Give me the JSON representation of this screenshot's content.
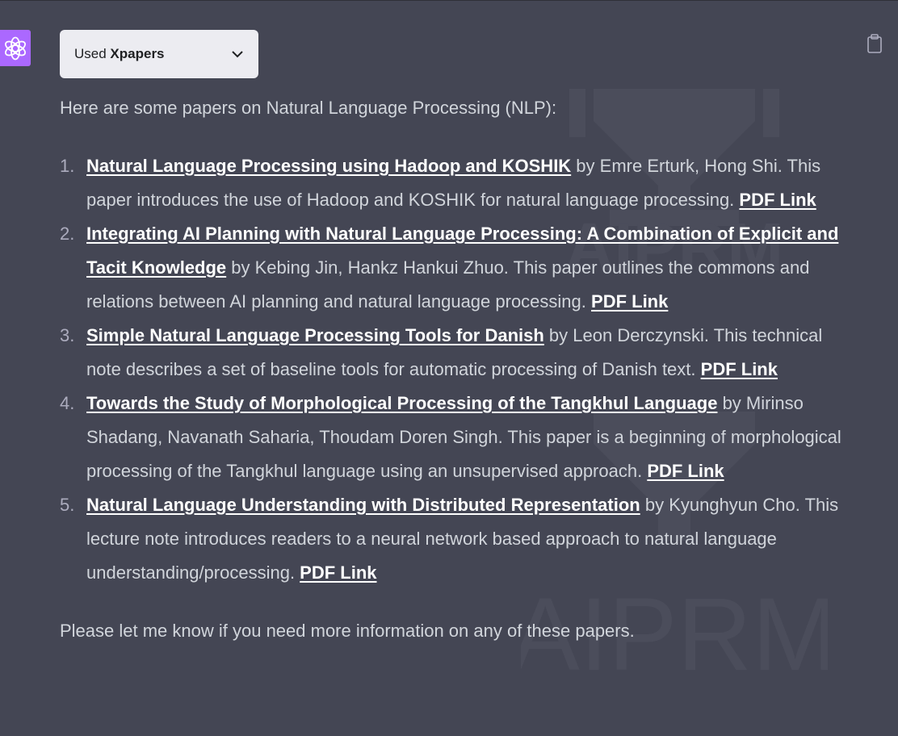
{
  "plugin": {
    "used_label": "Used",
    "plugin_name": "Xpapers"
  },
  "watermark": {
    "text": "AIPRM"
  },
  "message": {
    "intro": "Here are some papers on Natural Language Processing (NLP):",
    "papers": [
      {
        "number": "1.",
        "title": "Natural Language Processing using Hadoop and KOSHIK",
        "description": " by Emre Erturk, Hong Shi. This paper introduces the use of Hadoop and KOSHIK for natural language processing. ",
        "link_label": "PDF Link"
      },
      {
        "number": "2.",
        "title": "Integrating AI Planning with Natural Language Processing: A Combination of Explicit and Tacit Knowledge",
        "description": " by Kebing Jin, Hankz Hankui Zhuo. This paper outlines the commons and relations between AI planning and natural language processing. ",
        "link_label": "PDF Link"
      },
      {
        "number": "3.",
        "title": "Simple Natural Language Processing Tools for Danish",
        "description": " by Leon Derczynski. This technical note describes a set of baseline tools for automatic processing of Danish text. ",
        "link_label": "PDF Link"
      },
      {
        "number": "4.",
        "title": "Towards the Study of Morphological Processing of the Tangkhul Language",
        "description": " by Mirinso Shadang, Navanath Saharia, Thoudam Doren Singh. This paper is a beginning of morphological processing of the Tangkhul language using an unsupervised approach. ",
        "link_label": "PDF Link"
      },
      {
        "number": "5.",
        "title": "Natural Language Understanding with Distributed Representation",
        "description": " by Kyunghyun Cho. This lecture note introduces readers to a neural network based approach to natural language understanding/processing. ",
        "link_label": "PDF Link"
      }
    ],
    "closing": "Please let me know if you need more information on any of these papers."
  },
  "icons": {
    "avatar": "openai-logo-icon",
    "dropdown": "chevron-down-icon",
    "copy": "clipboard-icon"
  },
  "colors": {
    "background": "#444654",
    "avatar_bg": "#ab68ff",
    "text": "#d1d5db",
    "link": "#ffffff",
    "dropdown_bg": "#ececf1"
  }
}
